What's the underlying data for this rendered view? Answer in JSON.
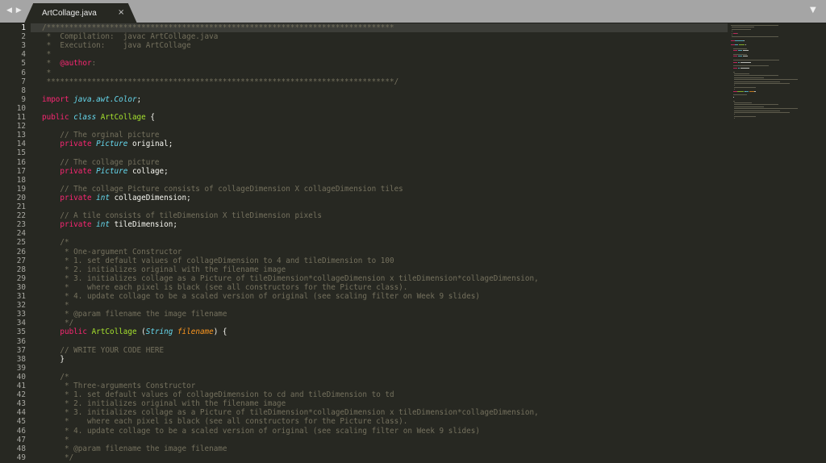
{
  "tabs": [
    {
      "title": "ArtCollage.java",
      "close": "×"
    }
  ],
  "nav": {
    "back": "◀",
    "forward": "▶"
  },
  "menu": {
    "more": "▼"
  },
  "editor": {
    "start_line": 1,
    "lines": [
      [
        [
          "c",
          "/*****************************************************************************"
        ]
      ],
      [
        [
          "c",
          " *  Compilation:  javac ArtCollage.java"
        ]
      ],
      [
        [
          "c",
          " *  Execution:    java ArtCollage"
        ]
      ],
      [
        [
          "c",
          " *"
        ]
      ],
      [
        [
          "c",
          " *  "
        ],
        [
          "k",
          "@author"
        ],
        [
          "c",
          ":"
        ]
      ],
      [
        [
          "c",
          " *"
        ]
      ],
      [
        [
          "c",
          " *****************************************************************************/"
        ]
      ],
      [],
      [
        [
          "k",
          "import "
        ],
        [
          "t",
          "java.awt.Color"
        ],
        [
          "pl",
          ";"
        ]
      ],
      [],
      [
        [
          "k",
          "public "
        ],
        [
          "t",
          "class "
        ],
        [
          "cls",
          "ArtCollage "
        ],
        [
          "pl",
          "{"
        ]
      ],
      [],
      [
        [
          "c",
          "    // The orginal picture"
        ]
      ],
      [
        [
          "k",
          "    private "
        ],
        [
          "t",
          "Picture "
        ],
        [
          "pl",
          "original;"
        ]
      ],
      [],
      [
        [
          "c",
          "    // The collage picture"
        ]
      ],
      [
        [
          "k",
          "    private "
        ],
        [
          "t",
          "Picture "
        ],
        [
          "pl",
          "collage;"
        ]
      ],
      [],
      [
        [
          "c",
          "    // The collage Picture consists of collageDimension X collageDimension tiles"
        ]
      ],
      [
        [
          "k",
          "    private "
        ],
        [
          "t",
          "int "
        ],
        [
          "pl",
          "collageDimension;"
        ]
      ],
      [],
      [
        [
          "c",
          "    // A tile consists of tileDimension X tileDimension pixels"
        ]
      ],
      [
        [
          "k",
          "    private "
        ],
        [
          "t",
          "int "
        ],
        [
          "pl",
          "tileDimension;"
        ]
      ],
      [],
      [
        [
          "c",
          "    /*"
        ]
      ],
      [
        [
          "c",
          "     * One-argument Constructor"
        ]
      ],
      [
        [
          "c",
          "     * 1. set default values of collageDimension to 4 and tileDimension to 100"
        ]
      ],
      [
        [
          "c",
          "     * 2. initializes original with the filename image"
        ]
      ],
      [
        [
          "c",
          "     * 3. initializes collage as a Picture of tileDimension*collageDimension x tileDimension*collageDimension,"
        ]
      ],
      [
        [
          "c",
          "     *    where each pixel is black (see all constructors for the Picture class)."
        ]
      ],
      [
        [
          "c",
          "     * 4. update collage to be a scaled version of original (see scaling filter on Week 9 slides)"
        ]
      ],
      [
        [
          "c",
          "     *"
        ]
      ],
      [
        [
          "c",
          "     * @param filename the image filename"
        ]
      ],
      [
        [
          "c",
          "     */"
        ]
      ],
      [
        [
          "k",
          "    public "
        ],
        [
          "cls",
          "ArtCollage "
        ],
        [
          "pl",
          "("
        ],
        [
          "t",
          "String "
        ],
        [
          "p",
          "filename"
        ],
        [
          "pl",
          ") {"
        ]
      ],
      [],
      [
        [
          "c",
          "    // WRITE YOUR CODE HERE"
        ]
      ],
      [
        [
          "pl",
          "    }"
        ]
      ],
      [],
      [
        [
          "c",
          "    /*"
        ]
      ],
      [
        [
          "c",
          "     * Three-arguments Constructor"
        ]
      ],
      [
        [
          "c",
          "     * 1. set default values of collageDimension to cd and tileDimension to td"
        ]
      ],
      [
        [
          "c",
          "     * 2. initializes original with the filename image"
        ]
      ],
      [
        [
          "c",
          "     * 3. initializes collage as a Picture of tileDimension*collageDimension x tileDimension*collageDimension,"
        ]
      ],
      [
        [
          "c",
          "     *    where each pixel is black (see all constructors for the Picture class)."
        ]
      ],
      [
        [
          "c",
          "     * 4. update collage to be a scaled version of original (see scaling filter on Week 9 slides)"
        ]
      ],
      [
        [
          "c",
          "     *"
        ]
      ],
      [
        [
          "c",
          "     * @param filename the image filename"
        ]
      ],
      [
        [
          "c",
          "     */"
        ]
      ]
    ]
  },
  "colors": {
    "comment": "#75715e",
    "keyword": "#f92672",
    "type": "#66d9ef",
    "class_name": "#a6e22e",
    "param": "#fd971f",
    "plain": "#f8f8f2",
    "background": "#272822"
  }
}
